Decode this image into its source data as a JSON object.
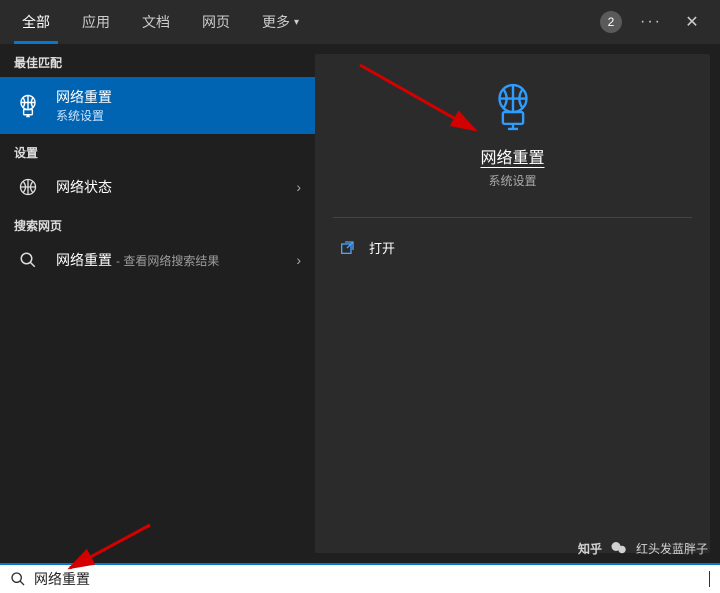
{
  "header": {
    "tabs": [
      "全部",
      "应用",
      "文档",
      "网页"
    ],
    "more_label": "更多",
    "count_badge": "2",
    "dots": "···"
  },
  "left": {
    "best_match_label": "最佳匹配",
    "best_match": {
      "title": "网络重置",
      "sub": "系统设置"
    },
    "settings_label": "设置",
    "settings_item": {
      "title": "网络状态"
    },
    "web_label": "搜索网页",
    "web_item": {
      "title": "网络重置",
      "sub": "- 查看网络搜索结果"
    }
  },
  "right": {
    "hero_title": "网络重置",
    "hero_sub": "系统设置",
    "open_label": "打开"
  },
  "search": {
    "value": "网络重置"
  },
  "watermark": {
    "brand": "知乎",
    "name": "红头发蓝胖子"
  }
}
